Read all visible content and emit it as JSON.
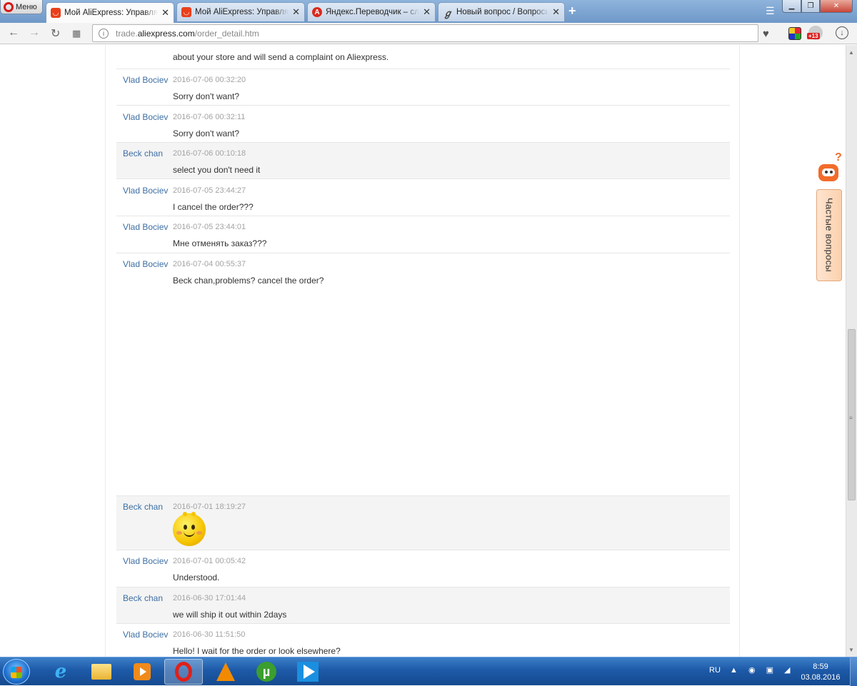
{
  "browser": {
    "menu_label": "Меню",
    "tabs": [
      {
        "title": "Мой AliExpress: Управлять заказами",
        "favicon": "aliexpress-icon",
        "active": true
      },
      {
        "title": "Мой AliExpress: Управлять заказами",
        "favicon": "aliexpress-icon",
        "active": false
      },
      {
        "title": "Яндекс.Переводчик – словарь и онлайн перевод",
        "favicon": "yandex-translate-icon",
        "active": false
      },
      {
        "title": "Новый вопрос / Вопросы и ответы",
        "favicon": "yandex-qa-icon",
        "active": false
      }
    ],
    "new_tab": "+",
    "url_host_prefix": "trade.",
    "url_host": "aliexpress.com",
    "url_path": "/order_detail.htm",
    "extension_badge": "+13"
  },
  "conversation": {
    "top_fragment": "about your store and will send a complaint on Aliexpress.",
    "messages": [
      {
        "author": "Vlad Bociev",
        "time": "2016-07-06 00:32:20",
        "text": "Sorry don't want?",
        "seller": false
      },
      {
        "author": "Vlad Bociev",
        "time": "2016-07-06 00:32:11",
        "text": "Sorry don't want?",
        "seller": false
      },
      {
        "author": "Beck chan",
        "time": "2016-07-06 00:10:18",
        "text": "select you don't need it",
        "seller": true
      },
      {
        "author": "Vlad Bociev",
        "time": "2016-07-05 23:44:27",
        "text": "I cancel the order???",
        "seller": false
      },
      {
        "author": "Vlad Bociev",
        "time": "2016-07-05 23:44:01",
        "text": "Мне отменять заказ???",
        "seller": false
      },
      {
        "author": "Vlad Bociev",
        "time": "2016-07-04 00:55:37",
        "text": "Beck chan,problems? cancel the order?",
        "seller": false
      },
      {
        "author": "Beck chan",
        "time": "2016-07-01 18:19:27",
        "text": "",
        "emoticon": "smiley-emoticon",
        "seller": true
      },
      {
        "author": "Vlad Bociev",
        "time": "2016-07-01 00:05:42",
        "text": "Understood.",
        "seller": false
      },
      {
        "author": "Beck chan",
        "time": "2016-06-30 17:01:44",
        "text": "we will ship it out within 2days",
        "seller": true
      },
      {
        "author": "Vlad Bociev",
        "time": "2016-06-30 11:51:50",
        "text": "Hello! I wait for the order or look elsewhere?",
        "seller": false
      }
    ]
  },
  "faq_widget": {
    "label": "Частые вопросы",
    "icon": "robot-help-icon"
  },
  "taskbar": {
    "language": "RU",
    "time": "8:59",
    "date": "03.08.2016",
    "pinned": [
      "internet-explorer-icon",
      "file-explorer-icon",
      "media-player-icon",
      "opera-icon",
      "vlc-icon",
      "utorrent-icon",
      "video-player-icon"
    ]
  },
  "colors": {
    "author_link": "#3d6fa4",
    "seller_row_bg": "#f4f4f4",
    "faq_accent": "#f26b2a"
  }
}
